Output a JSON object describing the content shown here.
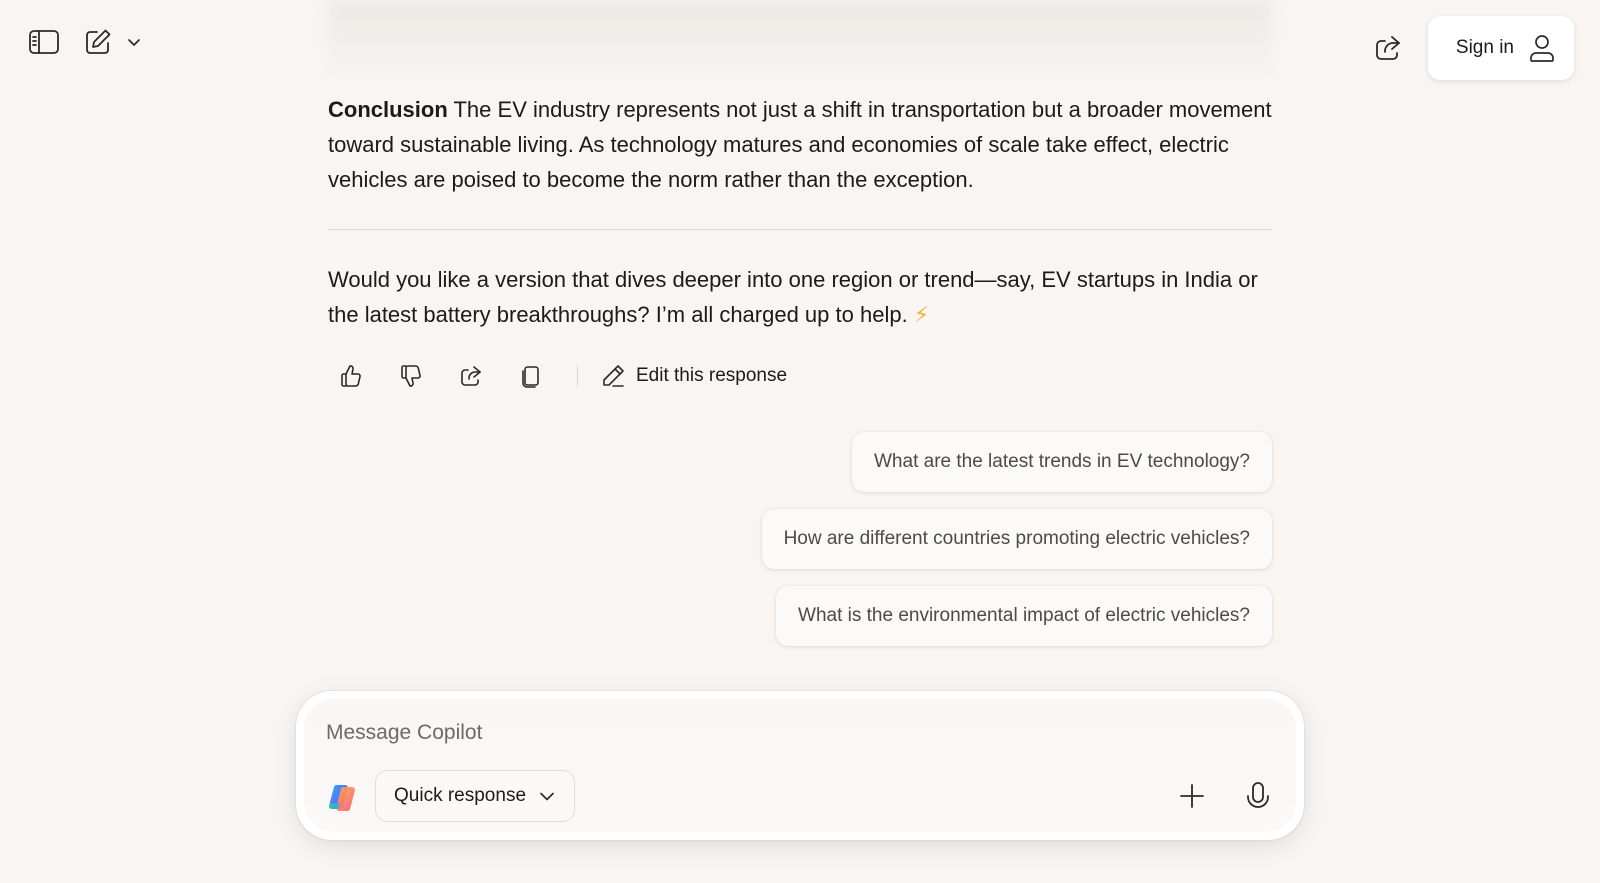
{
  "topbar": {
    "sidebar_icon": "sidebar-toggle-icon",
    "compose_icon": "new-chat-icon",
    "chevron_icon": "chevron-down-icon",
    "share_icon": "share-icon",
    "sign_in_label": "Sign in",
    "user_icon": "person-icon"
  },
  "conversation": {
    "conclusion_heading": "Conclusion",
    "conclusion_text": " The EV industry represents not just a shift in transportation but a broader movement toward sustainable living. As technology matures and economies of scale take effect, electric vehicles are poised to become the norm rather than the exception.",
    "followup_text": "Would you like a version that dives deeper into one region or trend—say, EV startups in India or the latest battery breakthroughs? I’m all charged up to help. ",
    "followup_emoji": "⚡"
  },
  "actions": {
    "like_icon": "thumbs-up-icon",
    "dislike_icon": "thumbs-down-icon",
    "share_icon": "share-icon",
    "copy_icon": "copy-icon",
    "edit_label": "Edit this response",
    "edit_icon": "pencil-icon"
  },
  "suggestions": [
    {
      "label": "What are the latest trends in EV technology?"
    },
    {
      "label": "How are different countries promoting electric vehicles?"
    },
    {
      "label": "What is the environmental impact of electric vehicles?"
    }
  ],
  "composer": {
    "placeholder": "Message Copilot",
    "value": "",
    "mode_label": "Quick response",
    "logo_icon": "copilot-logo-icon",
    "add_icon": "plus-icon",
    "mic_icon": "microphone-icon"
  },
  "colors": {
    "background": "#f8f5f2",
    "divider": "#e9d4c4",
    "text": "#1c1b1a",
    "suggestion_text": "#4d4a47"
  }
}
